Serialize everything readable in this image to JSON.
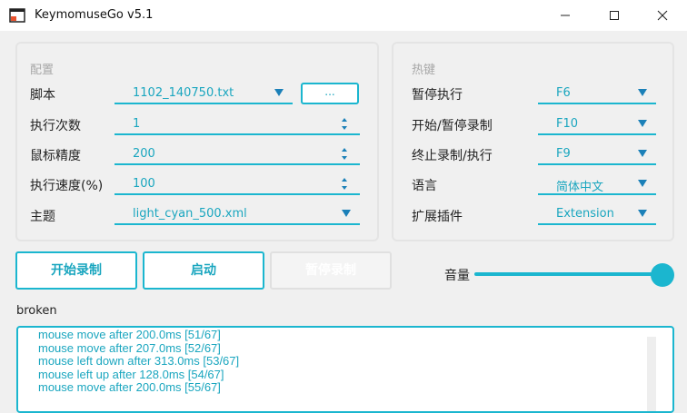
{
  "window": {
    "title": "KeymomuseGo v5.1",
    "minimize": "–",
    "maximize": "☐",
    "close": "✕"
  },
  "config": {
    "section_title": "配置",
    "script_label": "脚本",
    "script_value": "1102_140750.txt",
    "browse_label": "...",
    "exec_count_label": "执行次数",
    "exec_count_value": "1",
    "mouse_precision_label": "鼠标精度",
    "mouse_precision_value": "200",
    "exec_speed_label": "执行速度(%)",
    "exec_speed_value": "100",
    "theme_label": "主题",
    "theme_value": "light_cyan_500.xml"
  },
  "hotkeys": {
    "section_title": "热键",
    "pause_exec_label": "暂停执行",
    "pause_exec_value": "F6",
    "start_pause_record_label": "开始/暂停录制",
    "start_pause_record_value": "F10",
    "stop_record_exec_label": "终止录制/执行",
    "stop_record_exec_value": "F9",
    "language_label": "语言",
    "language_value": "简体中文",
    "plugin_label": "扩展插件",
    "plugin_value": "Extension"
  },
  "actions": {
    "start_record": "开始录制",
    "launch": "启动",
    "pause_record": "暂停录制"
  },
  "volume": {
    "label": "音量",
    "level": 1.0
  },
  "status": "broken",
  "log": [
    "mouse move after 200.0ms [51/67]",
    "mouse move after 207.0ms [52/67]",
    "mouse left down after 313.0ms [53/67]",
    "mouse left up after 128.0ms [54/67]",
    "mouse move after 200.0ms [55/67]"
  ],
  "colors": {
    "accent": "#1bb6cf",
    "arrow": "#1b80b8",
    "text_accent": "#1aa6bf"
  }
}
